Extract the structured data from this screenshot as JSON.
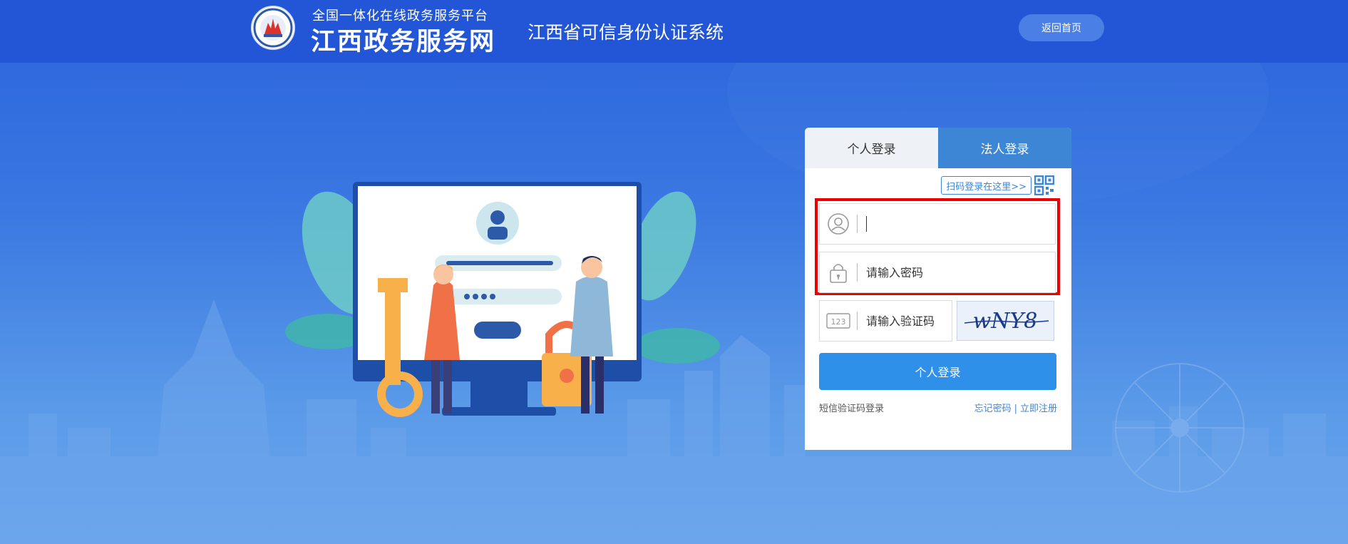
{
  "header": {
    "platform_subtitle": "全国一体化在线政务服务平台",
    "site_name": "江西政务服务网",
    "system_title": "江西省可信身份认证系统",
    "back_home_label": "返回首页"
  },
  "login": {
    "tabs": [
      {
        "label": "个人登录",
        "active": true
      },
      {
        "label": "法人登录",
        "active": false
      }
    ],
    "qr_tip": "扫码登录在这里>>",
    "username": {
      "value": "",
      "placeholder": ""
    },
    "password": {
      "placeholder": "请输入密码"
    },
    "captcha": {
      "placeholder": "请输入验证码",
      "image_text": "wNY8"
    },
    "submit_label": "个人登录",
    "sms_login_label": "短信验证码登录",
    "forgot_password_label": "忘记密码",
    "link_divider": "|",
    "register_label": "立即注册"
  },
  "icons": {
    "user": "user-circle-icon",
    "lock": "lock-icon",
    "captcha": "number-123-icon",
    "qr": "qr-code-icon"
  },
  "colors": {
    "header_bg": "#2356d6",
    "tab_inactive": "#3d86d6",
    "primary_button": "#2e90e8",
    "highlight": "#ee0000",
    "link": "#3d86d6"
  }
}
